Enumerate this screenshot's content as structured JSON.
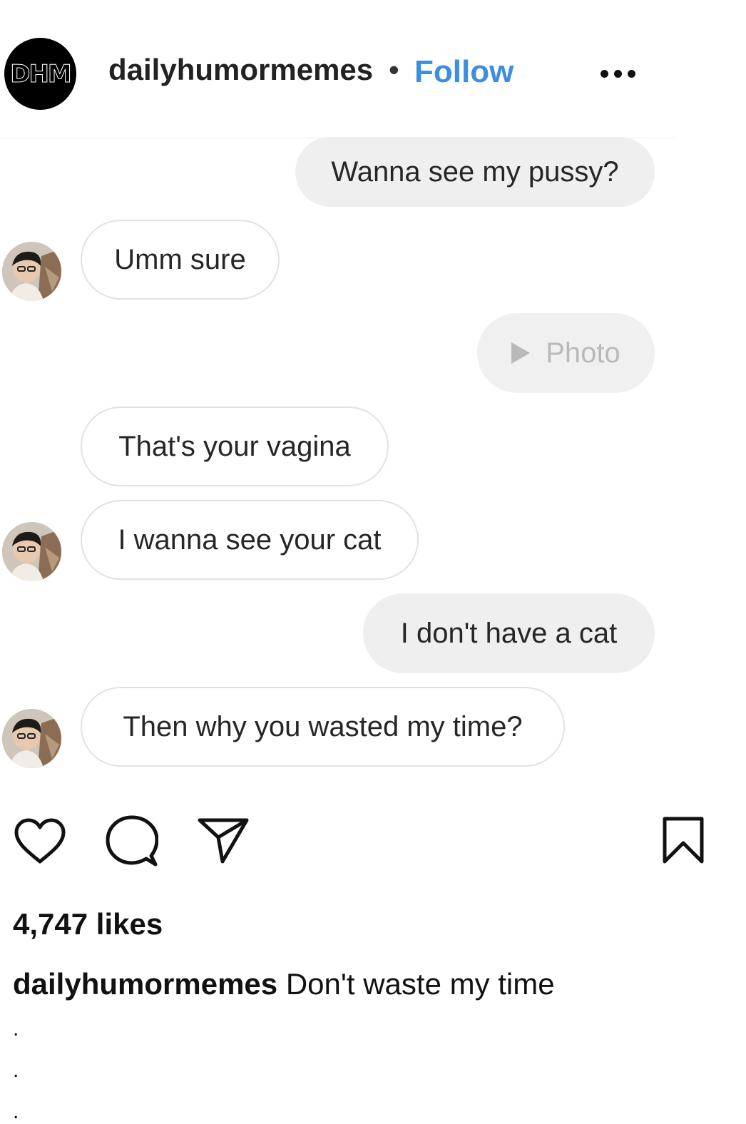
{
  "post_header": {
    "logo_text": "DHM",
    "username": "dailyhumormemes",
    "separator": "•",
    "follow_label": "Follow"
  },
  "chat": {
    "messages": [
      {
        "side": "out",
        "text": "Wanna see my pussy?"
      },
      {
        "side": "in",
        "text": "Umm sure"
      },
      {
        "side": "out",
        "text": "Photo",
        "type": "photo"
      },
      {
        "side": "in",
        "text": "That's your vagina"
      },
      {
        "side": "in",
        "text": "I wanna see your cat"
      },
      {
        "side": "out",
        "text": "I don't have a cat"
      },
      {
        "side": "in",
        "text": "Then why you wasted my time?"
      }
    ]
  },
  "actions": {
    "icons": [
      "heart-icon",
      "comment-icon",
      "share-icon",
      "bookmark-icon"
    ]
  },
  "likes_text": "4,747 likes",
  "caption": {
    "username": "dailyhumormemes",
    "text": "Don't waste my time",
    "trailing_dots": [
      ".",
      ".",
      "."
    ]
  }
}
